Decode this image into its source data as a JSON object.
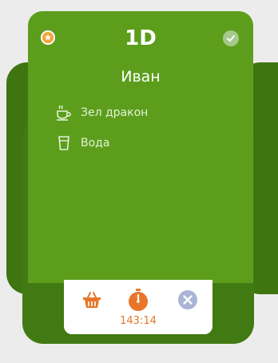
{
  "card": {
    "table_code": "1D",
    "guest_name": "Иван",
    "items": [
      {
        "label": "Зел дракон",
        "icon": "teacup-icon"
      },
      {
        "label": "Вода",
        "icon": "glass-icon"
      }
    ]
  },
  "actions": {
    "timer": "143:14",
    "basket_icon": "basket-icon",
    "stopwatch_icon": "stopwatch-icon",
    "close_icon": "close-icon"
  },
  "colors": {
    "card": "#5c9e1c",
    "frame": "#417a12",
    "accent": "#e8762a",
    "star": "#f2a13b",
    "check": "#a5c98a",
    "close": "#a9b4d6"
  }
}
